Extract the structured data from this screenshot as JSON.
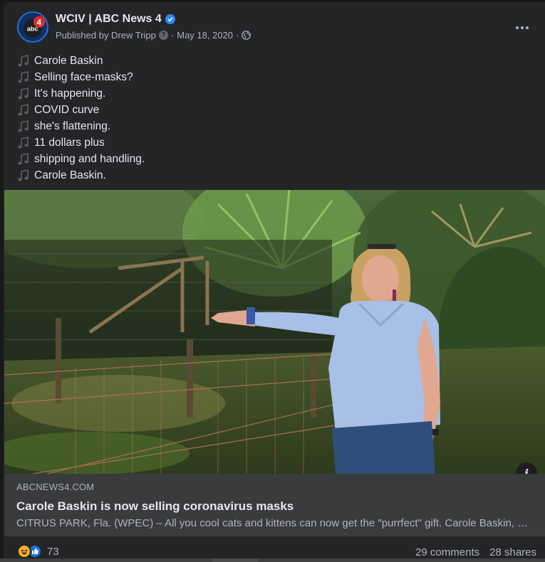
{
  "post": {
    "page_name": "WCIV | ABC News 4",
    "published_by": "Published by Drew Tripp",
    "date": "May 18, 2020",
    "separator": "·",
    "avatar_text": "abc",
    "avatar_number": "4",
    "lines": [
      "Carole Baskin",
      "Selling face-masks?",
      "It's happening.",
      "COVID curve",
      "she's flattening.",
      "11 dollars plus",
      "shipping and handling.",
      "Carole Baskin."
    ]
  },
  "link_preview": {
    "domain": "ABCNEWS4.COM",
    "title": "Carole Baskin is now selling coronavirus masks",
    "description": "CITRUS PARK, Fla. (WPEC) – All you cool cats and kittens can now get the \"purrfect\" gift. Carole Baskin, star of the Netflix series Tiger King, is now selling masks."
  },
  "footer": {
    "reaction_count": "73",
    "comments": "29 comments",
    "shares": "28 shares"
  },
  "icons": {
    "verified": "verified-badge-icon",
    "help": "question-icon",
    "audience": "globe-icon",
    "more": "more-options-icon",
    "music": "musical-note-icon",
    "info": "info-icon",
    "reactions": [
      "haha-reaction-icon",
      "like-reaction-icon"
    ]
  },
  "colors": {
    "card_bg": "#242526",
    "link_box_bg": "#3a3b3c",
    "verified_blue": "#2d88ff",
    "like_blue": "#1b74e4",
    "haha_yellow": "#f7b125",
    "primary_text": "#e4e6eb",
    "secondary_text": "#b0b3b8"
  }
}
